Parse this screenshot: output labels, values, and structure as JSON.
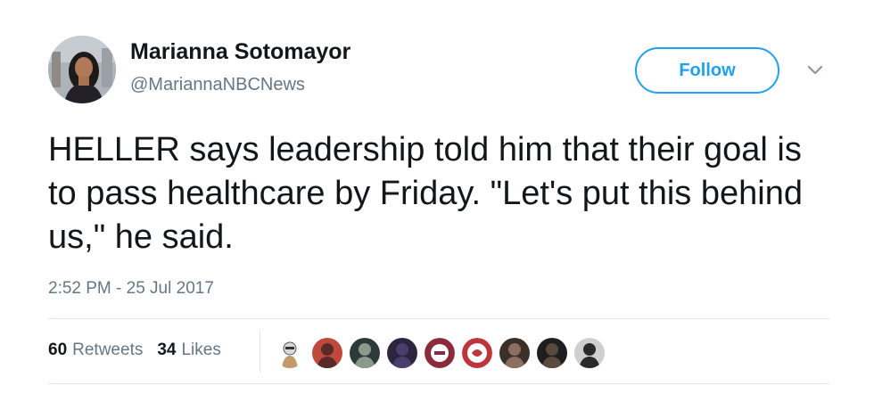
{
  "author": {
    "name": "Marianna Sotomayor",
    "handle": "@MariannaNBCNews"
  },
  "actions": {
    "follow_label": "Follow",
    "more_icon": "chevron-down-icon"
  },
  "tweet": {
    "text": "HELLER says leadership told him that their goal is to pass healthcare by Friday. \"Let's put this behind us,\" he said.",
    "timestamp": "2:52 PM - 25 Jul 2017"
  },
  "stats": {
    "retweets_count": "60",
    "retweets_label": "Retweets",
    "likes_count": "34",
    "likes_label": "Likes"
  },
  "likers": [
    {
      "icon": "cartoon-avatar",
      "colors": [
        "#d9d9d9",
        "#c49a6c"
      ]
    },
    {
      "icon": "photo-avatar",
      "colors": [
        "#c04a3a",
        "#5a2a2a"
      ]
    },
    {
      "icon": "photo-avatar",
      "colors": [
        "#2c3a3a",
        "#8a9a8a"
      ]
    },
    {
      "icon": "photo-avatar",
      "colors": [
        "#2b2540",
        "#4a3f6a"
      ]
    },
    {
      "icon": "badge-avatar",
      "colors": [
        "#8a2a3a",
        "#ffffff"
      ]
    },
    {
      "icon": "logo-avatar",
      "colors": [
        "#c0343c",
        "#ffffff"
      ]
    },
    {
      "icon": "photo-avatar",
      "colors": [
        "#3a3028",
        "#8a7060"
      ]
    },
    {
      "icon": "photo-avatar",
      "colors": [
        "#1e1e1e",
        "#5a4a40"
      ]
    },
    {
      "icon": "photo-avatar",
      "colors": [
        "#cfcfcf",
        "#2a2a2a"
      ]
    }
  ],
  "colors": {
    "accent": "#1da1f2",
    "text": "#14171a",
    "secondary": "#657786",
    "divider": "#e1e8ed"
  }
}
